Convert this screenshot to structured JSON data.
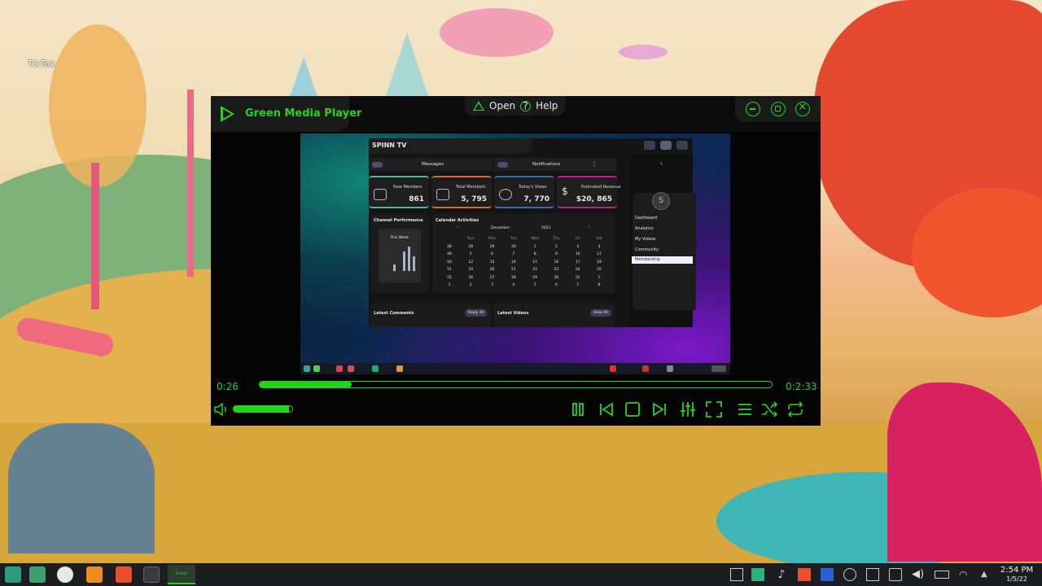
{
  "desktop": {
    "icon_label": "TikTok"
  },
  "player": {
    "title": "Green Media Player",
    "menu": {
      "open": "Open",
      "help": "Help"
    },
    "accent": "#25d31f",
    "time_elapsed": "0:26",
    "time_total": "0:2:33",
    "progress_fraction": 0.18,
    "volume_fraction": 0.95,
    "controls": [
      "pause-icon",
      "previous-icon",
      "stop-icon",
      "next-icon",
      "equalizer-icon",
      "fullscreen-icon",
      "playlist-icon",
      "shuffle-icon",
      "repeat-icon"
    ]
  },
  "video": {
    "app_title": "SPINN TV",
    "messages": "Messages",
    "notifications": "Notifications",
    "stats": [
      {
        "label": "New Members",
        "value": "861",
        "color": "#4fb3a6"
      },
      {
        "label": "Total Members",
        "value": "5, 795",
        "color": "#e0682e"
      },
      {
        "label": "Today's Views",
        "value": "7, 770",
        "color": "#3b6ba8"
      },
      {
        "label": "Estimated Revenue",
        "value": "$20, 865",
        "color": "#c21f8c"
      }
    ],
    "channel_performance": "Channel Performance",
    "this_week": "This Week",
    "calendar_title": "Calendar Activities",
    "calendar_month": "December",
    "calendar_year": "2021",
    "weekdays": [
      "Sun",
      "Mon",
      "Tue",
      "Wed",
      "Thu",
      "Fri",
      "Sat"
    ],
    "weeks": [
      [
        "48",
        "28",
        "29",
        "30",
        "1",
        "2",
        "3",
        "4"
      ],
      [
        "49",
        "5",
        "6",
        "7",
        "8",
        "9",
        "10",
        "11"
      ],
      [
        "50",
        "12",
        "13",
        "14",
        "15",
        "16",
        "17",
        "18"
      ],
      [
        "51",
        "19",
        "20",
        "21",
        "22",
        "23",
        "24",
        "25"
      ],
      [
        "52",
        "26",
        "27",
        "28",
        "29",
        "30",
        "31",
        "1"
      ],
      [
        "1",
        "2",
        "3",
        "4",
        "5",
        "6",
        "7",
        "8"
      ]
    ],
    "latest_comments": "Latest Comments",
    "reply_all": "Reply All",
    "latest_videos": "Latest Videos",
    "view_all": "View All",
    "sidebar": [
      "Dashboard",
      "Analytics",
      "My Videos",
      "Community",
      "Membership"
    ],
    "sidebar_selected": "Membership",
    "avatar_letter": "S"
  },
  "taskbar": {
    "active_label": "Green",
    "time": "2:54 PM",
    "date": "1/5/22"
  }
}
